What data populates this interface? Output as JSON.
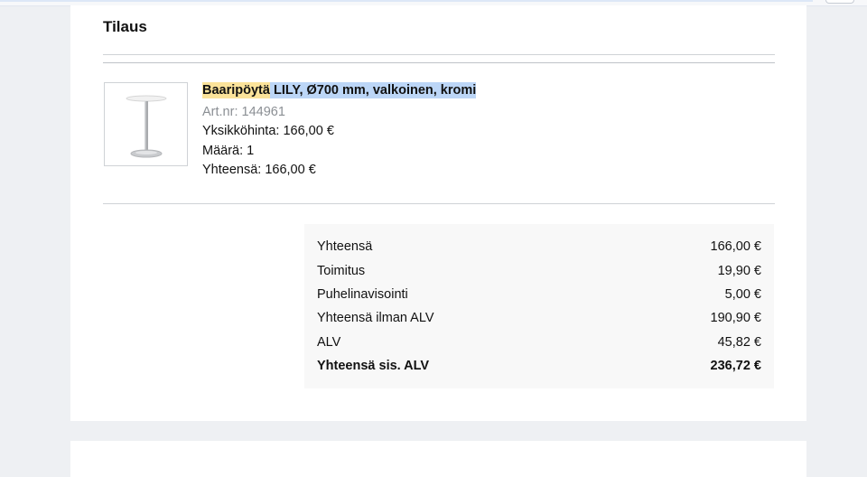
{
  "order": {
    "title": "Tilaus",
    "product": {
      "name_part1": "Baaripöytä",
      "name_part2": "LILY, Ø700 mm, valkoinen, kromi",
      "article": "Art.nr: 144961",
      "unit_price": "Yksikköhinta: 166,00 €",
      "quantity": "Määrä: 1",
      "line_total": "Yhteensä: 166,00 €",
      "image_icon": "bar-table-icon"
    },
    "summary": [
      {
        "label": "Yhteensä",
        "value": "166,00 €"
      },
      {
        "label": "Toimitus",
        "value": "19,90 €"
      },
      {
        "label": "Puhelinavisointi",
        "value": "5,00 €"
      },
      {
        "label": "Yhteensä ilman ALV",
        "value": "190,90 €"
      },
      {
        "label": "ALV",
        "value": "45,82 €"
      },
      {
        "label": "Yhteensä sis. ALV",
        "value": "236,72 €"
      }
    ]
  },
  "colors": {
    "highlight_yellow": "#fbe39a",
    "highlight_blue": "#bcd6f7",
    "page_bg": "#eef0f3",
    "summary_bg": "#f8f8f8"
  }
}
